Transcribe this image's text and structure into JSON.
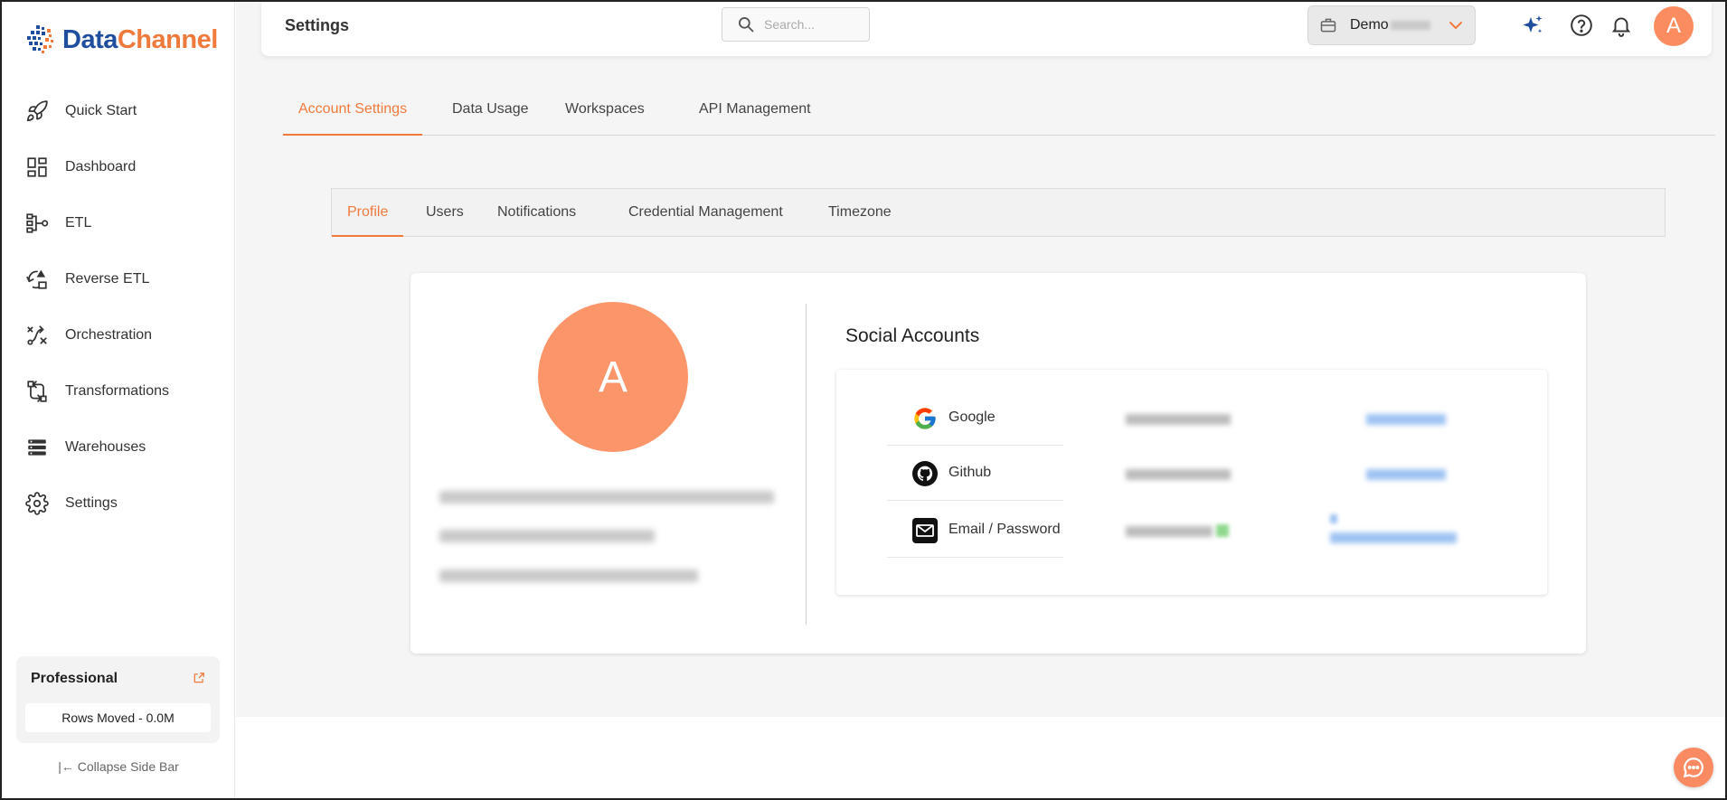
{
  "brand": {
    "name_part1": "Data",
    "name_part2": "Channel",
    "accent": "#f07a3c",
    "primary": "#1f4e9e"
  },
  "sidebar": {
    "items": [
      {
        "label": "Quick Start",
        "icon": "rocket-icon"
      },
      {
        "label": "Dashboard",
        "icon": "dashboard-icon"
      },
      {
        "label": "ETL",
        "icon": "etl-icon"
      },
      {
        "label": "Reverse ETL",
        "icon": "reverse-etl-icon"
      },
      {
        "label": "Orchestration",
        "icon": "orchestration-icon"
      },
      {
        "label": "Transformations",
        "icon": "transformations-icon"
      },
      {
        "label": "Warehouses",
        "icon": "warehouses-icon"
      },
      {
        "label": "Settings",
        "icon": "gear-icon"
      }
    ],
    "plan": {
      "name": "Professional",
      "rows_moved": "Rows Moved - 0.0M"
    },
    "collapse_label": "Collapse Side Bar"
  },
  "header": {
    "title": "Settings",
    "search_placeholder": "Search...",
    "workspace": "Demo",
    "avatar_initial": "A"
  },
  "top_tabs": {
    "items": [
      "Account Settings",
      "Data Usage",
      "Workspaces",
      "API Management"
    ],
    "active": "Account Settings"
  },
  "sub_tabs": {
    "items": [
      "Profile",
      "Users",
      "Notifications",
      "Credential Management",
      "Timezone"
    ],
    "active": "Profile"
  },
  "profile": {
    "avatar_initial": "A",
    "social_title": "Social Accounts",
    "social_accounts": [
      {
        "provider": "Google",
        "icon": "google-icon"
      },
      {
        "provider": "Github",
        "icon": "github-icon"
      },
      {
        "provider": "Email / Password",
        "icon": "email-icon"
      }
    ]
  }
}
